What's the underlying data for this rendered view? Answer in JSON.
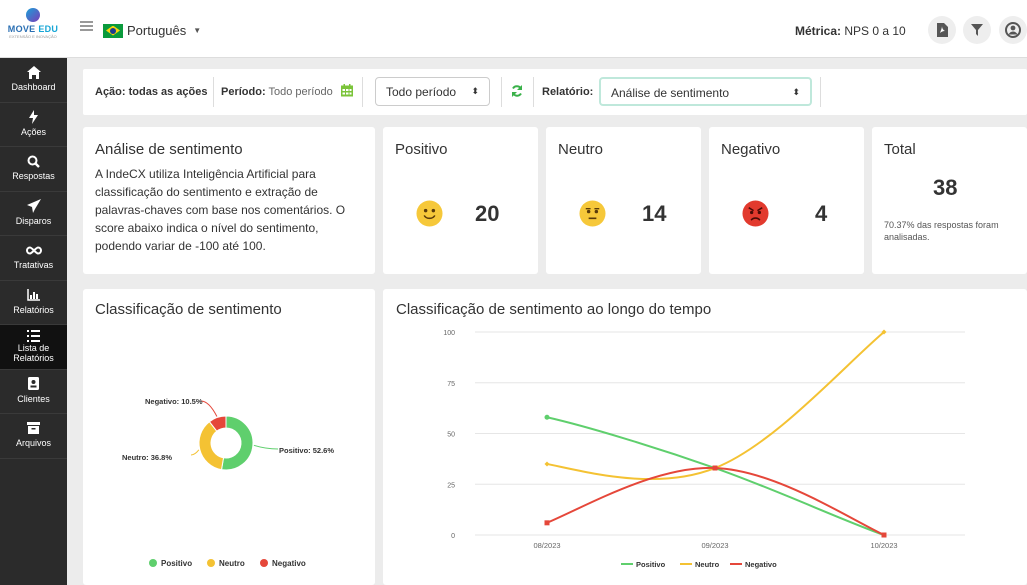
{
  "header": {
    "logo_text_1": "MOVE",
    "logo_text_2": "EDU",
    "logo_tagline": "EXTENSÃO E INOVAÇÃO",
    "language": "Português",
    "metric_label": "Métrica:",
    "metric_value": "NPS 0 a 10"
  },
  "sidebar": {
    "items": [
      {
        "label": "Dashboard",
        "icon": "home-icon"
      },
      {
        "label": "Ações",
        "icon": "bolt-icon"
      },
      {
        "label": "Respostas",
        "icon": "search-icon"
      },
      {
        "label": "Disparos",
        "icon": "send-icon"
      },
      {
        "label": "Tratativas",
        "icon": "infinity-icon"
      },
      {
        "label": "Relatórios",
        "icon": "bar-chart-icon"
      },
      {
        "label_1": "Lista de",
        "label_2": "Relatórios",
        "icon": "list-icon",
        "active": true
      },
      {
        "label": "Clientes",
        "icon": "id-card-icon"
      },
      {
        "label": "Arquivos",
        "icon": "archive-icon"
      }
    ]
  },
  "filters": {
    "acao": "Ação: todas as ações",
    "periodo_label": "Período:",
    "periodo_value": "Todo período",
    "periodo_select": "Todo período",
    "relatorio_label": "Relatório:",
    "relatorio_select": "Análise de sentimento"
  },
  "intro": {
    "title": "Análise de sentimento",
    "text": "A IndeCX utiliza Inteligência Artificial para classificação do sentimento e extração de palavras-chaves com base nos comentários. O score abaixo indica o nível do sentimento, podendo variar de -100 até 100."
  },
  "stats": {
    "positivo": {
      "label": "Positivo",
      "value": "20"
    },
    "neutro": {
      "label": "Neutro",
      "value": "14"
    },
    "negativo": {
      "label": "Negativo",
      "value": "4"
    },
    "total": {
      "label": "Total",
      "value": "38",
      "note": "70.37% das respostas foram analisadas."
    }
  },
  "colors": {
    "positivo": "#5fcf6d",
    "neutro": "#f4c233",
    "negativo": "#e5473a"
  },
  "chart_data": [
    {
      "type": "pie",
      "title": "Classificação de sentimento",
      "categories": [
        "Positivo",
        "Neutro",
        "Negativo"
      ],
      "values": [
        52.6,
        36.8,
        10.5
      ],
      "labels": [
        "Positivo: 52.6%",
        "Neutro: 36.8%",
        "Negativo: 10.5%"
      ],
      "legend": "bottom"
    },
    {
      "type": "line",
      "title": "Classificação de sentimento ao longo do tempo",
      "categories": [
        "08/2023",
        "09/2023",
        "10/2023"
      ],
      "ylim": [
        0,
        100
      ],
      "yticks": [
        "0",
        "25",
        "50",
        "75",
        "100"
      ],
      "grid": true,
      "legend": "bottom",
      "series": [
        {
          "name": "Positivo",
          "values": [
            58,
            33,
            0
          ]
        },
        {
          "name": "Neutro",
          "values": [
            35,
            33,
            100
          ]
        },
        {
          "name": "Negativo",
          "values": [
            6,
            33,
            0
          ]
        }
      ]
    }
  ]
}
